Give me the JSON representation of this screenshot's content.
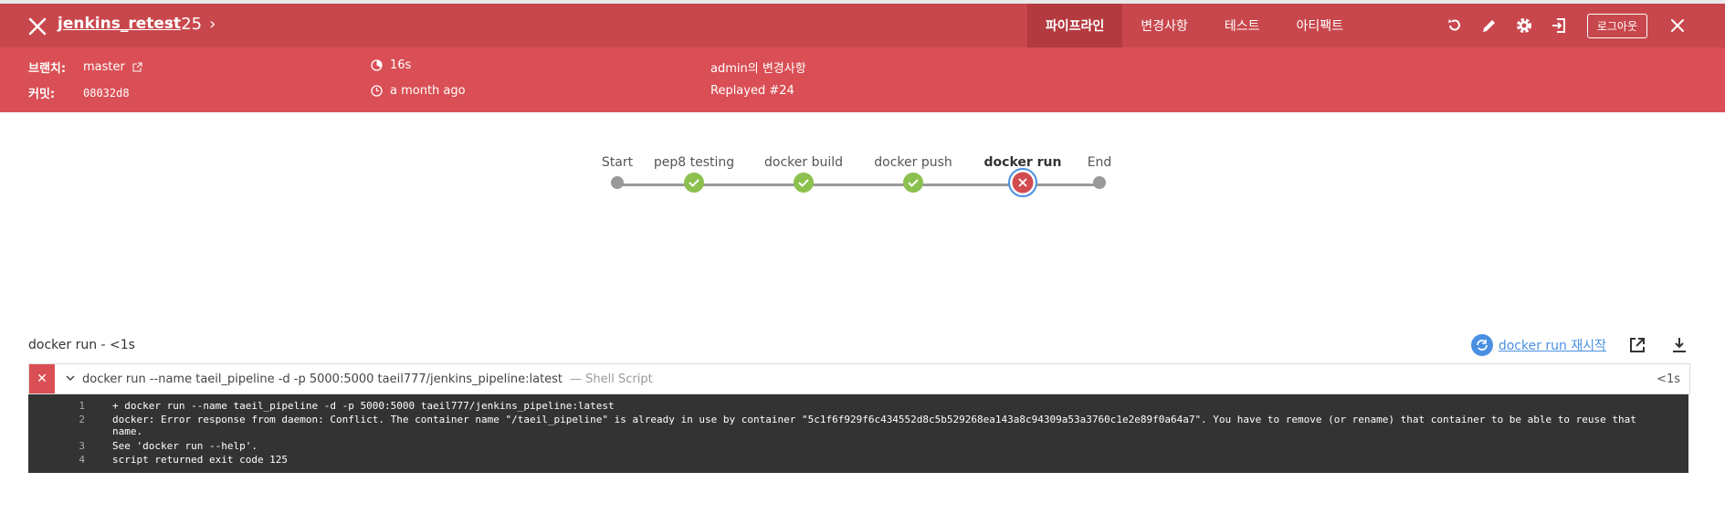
{
  "header": {
    "title": "jenkins_retest",
    "run_number": "25",
    "tabs": [
      {
        "label": "파이프라인",
        "active": true
      },
      {
        "label": "변경사항",
        "active": false
      },
      {
        "label": "테스트",
        "active": false
      },
      {
        "label": "아티팩트",
        "active": false
      }
    ],
    "logout_label": "로그아웃",
    "icons": [
      "replay-icon",
      "edit-icon",
      "settings-icon",
      "exit-icon",
      "close-icon"
    ]
  },
  "meta": {
    "branch_label": "브랜치:",
    "branch_value": "master",
    "commit_label": "커밋:",
    "commit_value": "08032d8",
    "duration": "16s",
    "time_ago": "a month ago",
    "changes": "admin의 변경사항",
    "replayed": "Replayed #24"
  },
  "pipeline": {
    "stages": [
      {
        "label": "Start",
        "status": "start"
      },
      {
        "label": "pep8 testing",
        "status": "success"
      },
      {
        "label": "docker build",
        "status": "success"
      },
      {
        "label": "docker push",
        "status": "success"
      },
      {
        "label": "docker run",
        "status": "failed",
        "selected": true
      },
      {
        "label": "End",
        "status": "end"
      }
    ]
  },
  "step_panel": {
    "title": "docker run - <1s",
    "restart_label": "docker run 재시작",
    "step_command": "docker run --name taeil_pipeline -d -p 5000:5000 taeil777/jenkins_pipeline:latest",
    "step_type": "— Shell Script",
    "step_duration": "<1s"
  },
  "log": {
    "lines": [
      {
        "n": "1",
        "text": "+ docker run --name taeil_pipeline -d -p 5000:5000 taeil777/jenkins_pipeline:latest"
      },
      {
        "n": "2",
        "text": "docker: Error response from daemon: Conflict. The container name \"/taeil_pipeline\" is already in use by container \"5c1f6f929f6c434552d8c5b529268ea143a8c94309a53a3760c1e2e89f0a64a7\". You have to remove (or rename) that container to be able to reuse that name."
      },
      {
        "n": "3",
        "text": "See 'docker run --help'."
      },
      {
        "n": "4",
        "text": "script returned exit code 125"
      }
    ]
  },
  "colors": {
    "header_bg": "#c8474c",
    "meta_bg": "#d94f55",
    "success": "#8cc04f",
    "failed": "#d24c4f",
    "link": "#4a90e2"
  }
}
